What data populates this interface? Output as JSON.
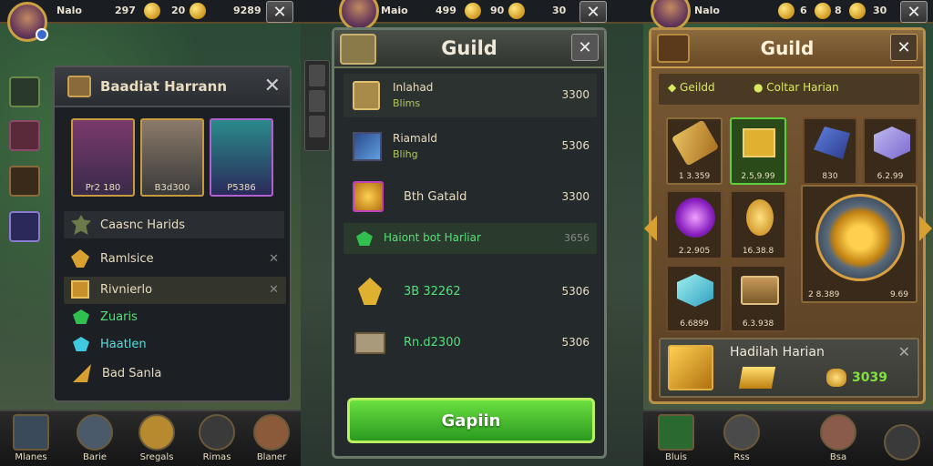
{
  "left": {
    "topbar": {
      "name": "Nalo",
      "value1": "297",
      "value2": "20",
      "value3": "9289"
    },
    "dialog_title": "Baadiat Harrann",
    "heroes": [
      "Pr2 180",
      "B3d300",
      "P5386"
    ],
    "list": [
      {
        "label": "Caasnc Harids",
        "color": "#e8dcc0",
        "icon": "gear-icon"
      },
      {
        "label": "Ramlsice",
        "color": "#e8dcc0",
        "icon": "gold-shard-icon"
      },
      {
        "label": "Rivnierlo",
        "color": "#e8dcc0",
        "icon": "gold-chest-icon"
      },
      {
        "label": "Zuaris",
        "color": "#55e07a",
        "icon": "green-gem-icon"
      },
      {
        "label": "Haatlen",
        "color": "#55e0e0",
        "icon": "blue-gem-icon"
      },
      {
        "label": "Bad Sanla",
        "color": "#e8dcc0",
        "icon": "gold-shard-icon"
      }
    ],
    "nav": [
      "Mlanes",
      "Barie",
      "Sregals",
      "Rimas",
      "Blaner"
    ]
  },
  "middle": {
    "topbar": {
      "name": "Maio",
      "value1": "499",
      "value2": "90",
      "value3": "30"
    },
    "title": "Guild",
    "rows": [
      {
        "name": "Inlahad",
        "sub": "Blims",
        "value": "3300"
      },
      {
        "name": "Riamald",
        "sub": "Blihg",
        "value": "5306"
      },
      {
        "name": "Bth Gatald",
        "sub": "",
        "value": "3300"
      },
      {
        "name": "Haiont bot Harliar",
        "sub": "",
        "value": "3656"
      },
      {
        "name": "3B 32262",
        "sub": "",
        "value": "5306"
      },
      {
        "name": "Rn.d2300",
        "sub": "",
        "value": "5306"
      }
    ],
    "button": "Gapiin"
  },
  "right": {
    "topbar": {
      "name": "Nalo",
      "value1": "6",
      "value2": "8",
      "value3": "30"
    },
    "title": "Guild",
    "tabs": [
      "Geildd",
      "Coltar Harian"
    ],
    "items": [
      {
        "label": "1 3.359"
      },
      {
        "label": "2.5,9.99"
      },
      {
        "label": "830"
      },
      {
        "label": "6.2.99"
      },
      {
        "label": "2.2.905"
      },
      {
        "label": "16.38.8"
      },
      {
        "label": "6.6899"
      },
      {
        "label": "6.3.938"
      }
    ],
    "big_item": {
      "label": "2 8.389",
      "label2": "9.69"
    },
    "footer": {
      "title": "Hadilah Harian",
      "value": "3039"
    },
    "nav": [
      "Bluis",
      "Rss",
      "Bsa",
      ""
    ]
  }
}
